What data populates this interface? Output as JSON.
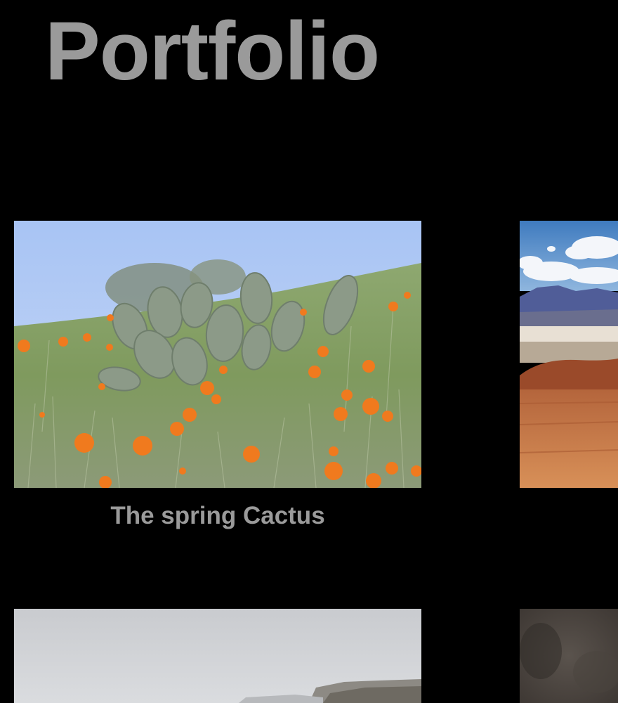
{
  "page": {
    "title": "Portfolio"
  },
  "gallery": {
    "items": [
      {
        "caption": "The spring Cactus",
        "image": "cactus-with-orange-poppies-photo"
      },
      {
        "caption": "",
        "image": "desert-mountain-landscape-photo"
      },
      {
        "caption": "",
        "image": "foggy-coastline-photo"
      },
      {
        "caption": "",
        "image": "dark-textured-photo"
      }
    ]
  },
  "colors": {
    "background": "#000000",
    "text": "#9a9a9a",
    "poppy": "#f07a1e"
  }
}
